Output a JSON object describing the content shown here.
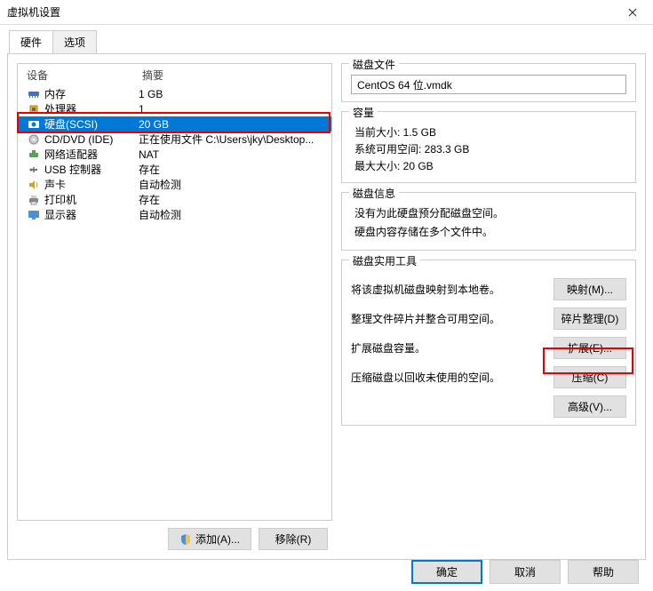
{
  "window": {
    "title": "虚拟机设置"
  },
  "tabs": [
    {
      "label": "硬件"
    },
    {
      "label": "选项"
    }
  ],
  "dev_header": {
    "device": "设备",
    "summary": "摘要"
  },
  "devices": [
    {
      "icon": "memory-icon",
      "name": "内存",
      "summary": "1 GB"
    },
    {
      "icon": "cpu-icon",
      "name": "处理器",
      "summary": "1"
    },
    {
      "icon": "disk-icon",
      "name": "硬盘(SCSI)",
      "summary": "20 GB"
    },
    {
      "icon": "cd-icon",
      "name": "CD/DVD (IDE)",
      "summary": "正在使用文件 C:\\Users\\jky\\Desktop..."
    },
    {
      "icon": "network-icon",
      "name": "网络适配器",
      "summary": "NAT"
    },
    {
      "icon": "usb-icon",
      "name": "USB 控制器",
      "summary": "存在"
    },
    {
      "icon": "sound-icon",
      "name": "声卡",
      "summary": "自动检测"
    },
    {
      "icon": "printer-icon",
      "name": "打印机",
      "summary": "存在"
    },
    {
      "icon": "display-icon",
      "name": "显示器",
      "summary": "自动检测"
    }
  ],
  "buttons": {
    "add": "添加(A)...",
    "remove": "移除(R)"
  },
  "disk_file": {
    "legend": "磁盘文件",
    "value": "CentOS 64 位.vmdk"
  },
  "capacity": {
    "legend": "容量",
    "rows": [
      {
        "label": "当前大小:",
        "value": "1.5 GB"
      },
      {
        "label": "系统可用空间:",
        "value": "283.3 GB"
      },
      {
        "label": "最大大小:",
        "value": "20 GB"
      }
    ]
  },
  "disk_info": {
    "legend": "磁盘信息",
    "lines": [
      "没有为此硬盘预分配磁盘空间。",
      "硬盘内容存储在多个文件中。"
    ]
  },
  "utilities": {
    "legend": "磁盘实用工具",
    "rows": [
      {
        "desc": "将该虚拟机磁盘映射到本地卷。",
        "btn": "映射(M)..."
      },
      {
        "desc": "整理文件碎片并整合可用空间。",
        "btn": "碎片整理(D)"
      },
      {
        "desc": "扩展磁盘容量。",
        "btn": "扩展(E)..."
      },
      {
        "desc": "压缩磁盘以回收未使用的空间。",
        "btn": "压缩(C)"
      }
    ],
    "advanced": "高级(V)..."
  },
  "footer": {
    "ok": "确定",
    "cancel": "取消",
    "help": "帮助"
  }
}
